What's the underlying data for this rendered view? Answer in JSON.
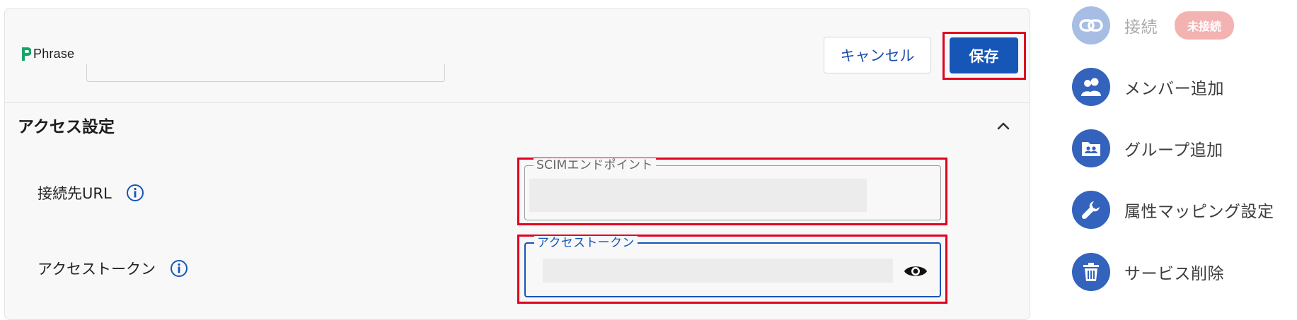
{
  "header": {
    "logo_text": "Phrase",
    "cancel_label": "キャンセル",
    "save_label": "保存"
  },
  "section": {
    "title": "アクセス設定",
    "collapse_icon": "chevron-up-icon"
  },
  "fields": {
    "endpoint": {
      "label": "接続先URL",
      "legend": "SCIMエンドポイント",
      "info_icon": "info-icon"
    },
    "token": {
      "label": "アクセストークン",
      "legend": "アクセストークン",
      "info_icon": "info-icon",
      "visibility_icon": "eye-icon"
    }
  },
  "sidebar": {
    "items": [
      {
        "label": "接続",
        "icon": "link-icon",
        "badge": "未接続",
        "disabled": true
      },
      {
        "label": "メンバー追加",
        "icon": "users-icon"
      },
      {
        "label": "グループ追加",
        "icon": "group-folder-icon"
      },
      {
        "label": "属性マッピング設定",
        "icon": "wrench-icon"
      },
      {
        "label": "サービス削除",
        "icon": "trash-icon"
      }
    ]
  },
  "colors": {
    "primary": "#1556b7",
    "highlight": "#e00020",
    "badge": "#f4b3b3"
  }
}
